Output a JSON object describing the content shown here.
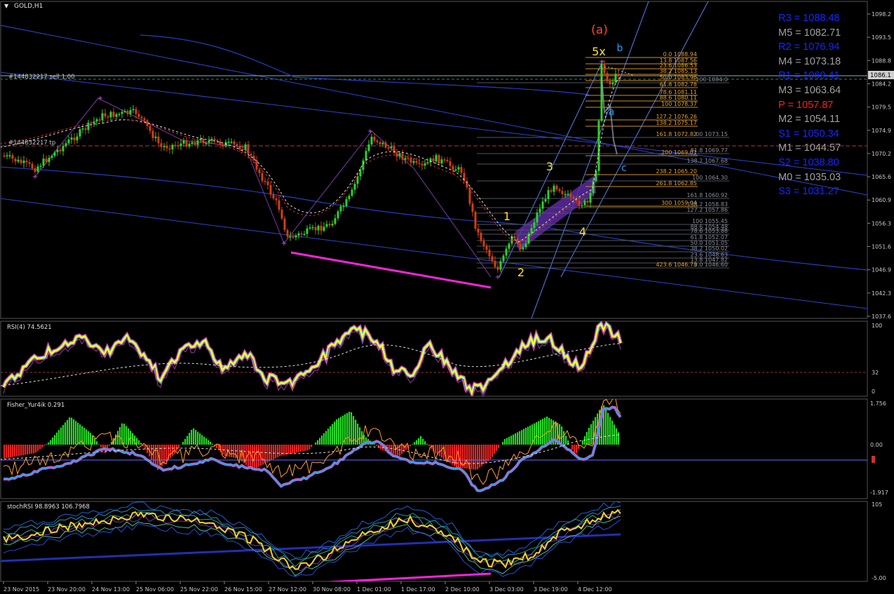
{
  "window": {
    "title": "GOLD,H1"
  },
  "trade_lines": {
    "sell": "#144832217 sell 1.00",
    "tp": "#144832217 tp"
  },
  "price_axis": {
    "ticks": [
      "1098.2",
      "1093.5",
      "1088.8",
      "1084.2",
      "1079.5",
      "1074.9",
      "1070.2",
      "1065.6",
      "1060.9",
      "1056.3",
      "1051.6",
      "1046.9",
      "1042.3",
      "1037.6"
    ],
    "current_price": "1086.1"
  },
  "time_axis": {
    "ticks": [
      "23 Nov 2015",
      "23 Nov 20:00",
      "24 Nov 13:00",
      "25 Nov 06:00",
      "25 Nov 22:00",
      "26 Nov 15:00",
      "27 Nov 12:00",
      "30 Nov 08:00",
      "1 Dec 01:00",
      "1 Dec 17:00",
      "2 Dec 10:00",
      "3 Dec 03:00",
      "3 Dec 19:00",
      "4 Dec 12:00"
    ]
  },
  "pivot_levels": [
    {
      "label": "R3 = 1088.48",
      "color": "#1428ff"
    },
    {
      "label": "M5 = 1082.71",
      "color": "#a0a0a0"
    },
    {
      "label": "R2 = 1076.94",
      "color": "#1428ff"
    },
    {
      "label": "M4 = 1073.18",
      "color": "#a0a0a0"
    },
    {
      "label": "R1 = 1069.41",
      "color": "#1428ff"
    },
    {
      "label": "M3 = 1063.64",
      "color": "#a0a0a0"
    },
    {
      "label": "P  = 1057.87",
      "color": "#ff1e1e"
    },
    {
      "label": "M2 = 1054.11",
      "color": "#a0a0a0"
    },
    {
      "label": "S1 = 1050.34",
      "color": "#1428ff"
    },
    {
      "label": "M1 = 1044.57",
      "color": "#a0a0a0"
    },
    {
      "label": "S2 = 1038.80",
      "color": "#1428ff"
    },
    {
      "label": "M0 = 1035.03",
      "color": "#a0a0a0"
    },
    {
      "label": "S3 = 1031.27",
      "color": "#1428ff"
    }
  ],
  "wave_labels": {
    "a_paren": "(a)",
    "five_x": "5x",
    "b": "b",
    "a": "a",
    "c": "c",
    "w1": "1",
    "w2": "2",
    "w3": "3",
    "w4": "4"
  },
  "fib_main": [
    "0.0 1088.94",
    "13.8 1087.56",
    "23.6 1086.53",
    "38.2 1085.13",
    "50.0 1083.96",
    "61.8 1082.78",
    "78.6 1081.11",
    "88.6 1080.11",
    "100 1078.37",
    "127.2 1076.26",
    "138.2 1075.17",
    "161.8 1072.82",
    "200 1069.01",
    "238.2 1065.20",
    "261.8 1062.85",
    "300 1059.04",
    "423.6 1046.73"
  ],
  "fib_right": [
    "100 1084.0",
    "00 1073.15",
    "81.8 1069.77",
    "138.2 1067.68",
    "100 1064.30",
    "161.8 1060.92",
    "138.2 1058.83",
    "127.2 1057.86",
    "100 1055.45",
    "88.6 1054.48",
    "78.6 1053.88",
    "61.8 1052.07",
    "50.0 1051.05",
    "38.2 1050.02",
    "23.6 1048.63",
    "13.8 1047.82",
    "0.0 1046.60"
  ],
  "indicators": {
    "rsi": {
      "title": "RSI(4) 74.5621",
      "scale": [
        "100",
        "32",
        "0"
      ]
    },
    "fisher": {
      "title": "Fisher_Yur4ik 0.291",
      "scale": [
        "1.756",
        "0.00",
        "-1.917"
      ]
    },
    "stochrsi": {
      "title": "stochRSI 98.8963 106.7968",
      "scale": [
        "105",
        "-5.00"
      ]
    }
  },
  "chart_data": [
    {
      "type": "line",
      "title": "GOLD,H1",
      "x": [
        "23 Nov 2015",
        "23 Nov 20:00",
        "24 Nov 13:00",
        "25 Nov 06:00",
        "25 Nov 22:00",
        "26 Nov 15:00",
        "27 Nov 12:00",
        "30 Nov 08:00",
        "1 Dec 01:00",
        "1 Dec 17:00",
        "2 Dec 10:00",
        "3 Dec 03:00",
        "3 Dec 19:00",
        "4 Dec 12:00"
      ],
      "series": [
        {
          "values": [
            1068.8,
            1070.1,
            1073.5,
            1077.0,
            1072.6,
            1068.5,
            1060.0,
            1055.6,
            1072.2,
            1068.2,
            1066.5,
            1049.5,
            1064.5,
            1086.2
          ]
        }
      ],
      "ylim": [
        1035.0,
        1100.5
      ]
    },
    {
      "type": "line",
      "title": "RSI(4) 74.5621",
      "x": [
        "23 Nov 2015",
        "23 Nov 20:00",
        "24 Nov 13:00",
        "25 Nov 06:00",
        "25 Nov 22:00",
        "26 Nov 15:00",
        "27 Nov 12:00",
        "30 Nov 08:00",
        "1 Dec 01:00",
        "1 Dec 17:00",
        "2 Dec 10:00",
        "3 Dec 03:00",
        "3 Dec 19:00",
        "4 Dec 12:00"
      ],
      "series": [
        {
          "values": [
            20,
            60,
            70,
            78,
            55,
            50,
            35,
            30,
            85,
            45,
            20,
            18,
            70,
            74.56
          ]
        }
      ],
      "ylim": [
        0,
        100
      ]
    },
    {
      "type": "bar",
      "title": "Fisher_Yur4ik 0.291",
      "x": [
        "23 Nov 2015",
        "23 Nov 20:00",
        "24 Nov 13:00",
        "25 Nov 06:00",
        "25 Nov 22:00",
        "26 Nov 15:00",
        "27 Nov 12:00",
        "30 Nov 08:00",
        "1 Dec 01:00",
        "1 Dec 17:00",
        "2 Dec 10:00",
        "3 Dec 03:00",
        "3 Dec 19:00",
        "4 Dec 12:00"
      ],
      "series": [
        {
          "values": [
            -0.5,
            0.2,
            1.0,
            -0.9,
            0.4,
            -0.6,
            -0.5,
            -1.2,
            1.4,
            -0.3,
            -1.1,
            -1.5,
            1.0,
            0.291
          ]
        }
      ],
      "ylim": [
        -1.917,
        1.756
      ]
    },
    {
      "type": "line",
      "title": "stochRSI 98.8963 106.7968",
      "x": [
        "23 Nov 2015",
        "23 Nov 20:00",
        "24 Nov 13:00",
        "25 Nov 06:00",
        "25 Nov 22:00",
        "26 Nov 15:00",
        "27 Nov 12:00",
        "30 Nov 08:00",
        "1 Dec 01:00",
        "1 Dec 17:00",
        "2 Dec 10:00",
        "3 Dec 03:00",
        "3 Dec 19:00",
        "4 Dec 12:00"
      ],
      "series": [
        {
          "values": [
            55,
            55,
            70,
            80,
            75,
            72,
            10,
            5,
            92,
            85,
            30,
            12,
            85,
            98.9
          ]
        }
      ],
      "ylim": [
        -5,
        105
      ]
    }
  ]
}
